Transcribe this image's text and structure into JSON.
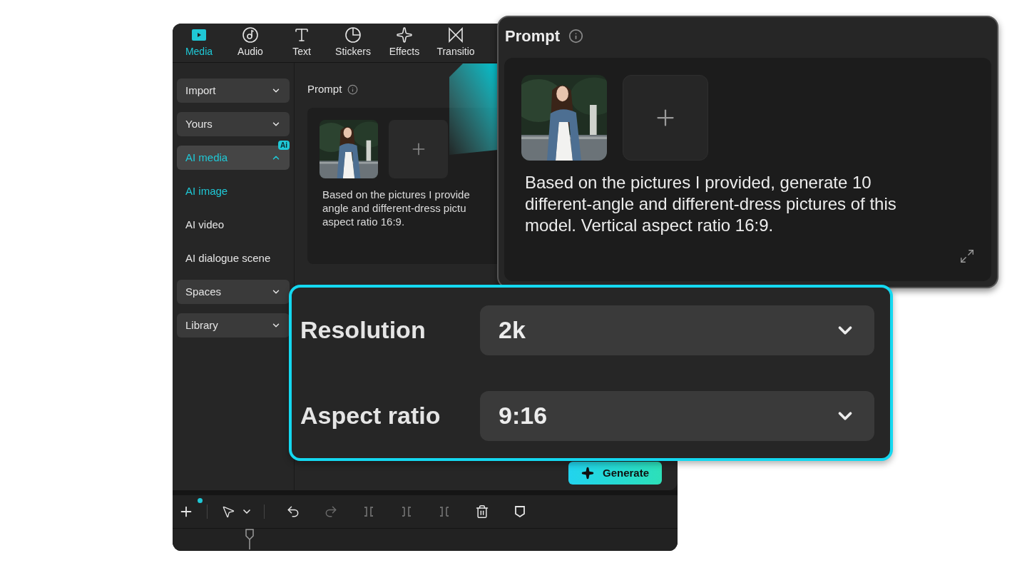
{
  "tabs": [
    {
      "label": "Media",
      "selected": true
    },
    {
      "label": "Audio",
      "selected": false
    },
    {
      "label": "Text",
      "selected": false
    },
    {
      "label": "Stickers",
      "selected": false
    },
    {
      "label": "Effects",
      "selected": false
    },
    {
      "label": "Transitio",
      "selected": false
    }
  ],
  "sidebar": {
    "items": [
      {
        "label": "Import",
        "selected": false,
        "expanded": false
      },
      {
        "label": "Yours",
        "selected": false,
        "expanded": false
      },
      {
        "label": "AI media",
        "selected": true,
        "expanded": true,
        "badge": "Ai",
        "children": [
          {
            "label": "AI image",
            "selected": true
          },
          {
            "label": "AI video",
            "selected": false
          },
          {
            "label": "AI dialogue scene",
            "selected": false
          }
        ]
      },
      {
        "label": "Spaces",
        "selected": false,
        "expanded": false
      },
      {
        "label": "Library",
        "selected": false,
        "expanded": false
      }
    ]
  },
  "prompt": {
    "title": "Prompt",
    "text_lines": [
      "Based on the pictures I provide",
      "angle and different-dress pictu",
      "aspect ratio 16:9."
    ]
  },
  "generate_button": "Generate",
  "toolbar": {
    "add_notification": true,
    "tools": [
      {
        "disabled": false
      },
      {
        "disabled": true
      },
      {
        "disabled": true
      },
      {
        "disabled": true
      },
      {
        "disabled": true
      },
      {
        "disabled": false
      },
      {
        "disabled": false
      }
    ]
  },
  "zoom_prompt": {
    "title": "Prompt",
    "text": "Based on the pictures I provided, generate 10 different-angle and different-dress pictures of this model. Vertical aspect ratio 16:9."
  },
  "settings": [
    {
      "label": "Resolution",
      "value": "2k"
    },
    {
      "label": "Aspect ratio",
      "value": "9:16"
    }
  ]
}
